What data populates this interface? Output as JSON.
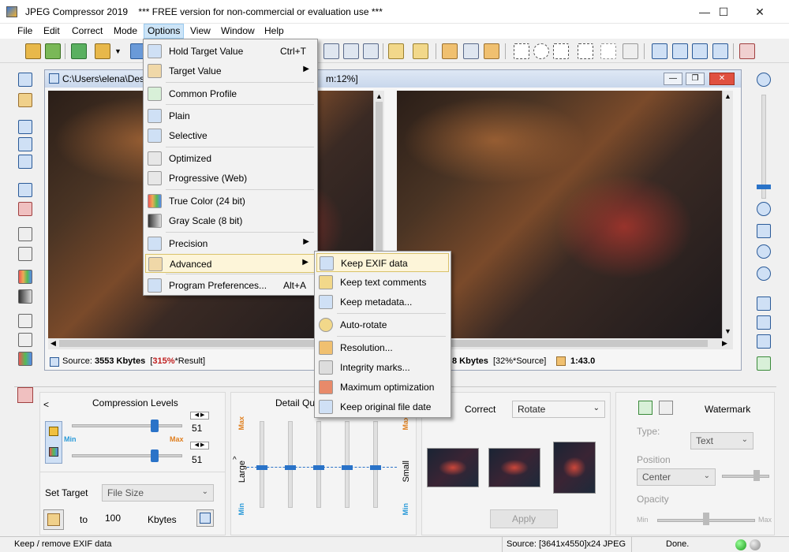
{
  "window": {
    "title": "JPEG Compressor 2019",
    "subtitle": "*** FREE version for non-commercial or evaluation use ***"
  },
  "menubar": [
    "File",
    "Edit",
    "Correct",
    "Mode",
    "Options",
    "View",
    "Window",
    "Help"
  ],
  "document": {
    "path": "C:\\Users\\elena\\Desk",
    "zoom_fragment": "m:12%]",
    "status_left": {
      "source_label": "Source:",
      "source_value": "3553 Kbytes",
      "percent": "315%",
      "percent_label": "*Result]",
      "open_bracket": "["
    },
    "status_right": {
      "kbytes": "8 Kbytes",
      "pct": "[32%*Source]",
      "ratio": "1:43.0"
    }
  },
  "options_menu": {
    "items": [
      {
        "label": "Hold Target Value",
        "shortcut": "Ctrl+T"
      },
      {
        "label": "Target Value",
        "submenu": true
      },
      {
        "label": "Common Profile"
      },
      {
        "label": "Plain"
      },
      {
        "label": "Selective"
      },
      {
        "label": "Optimized"
      },
      {
        "label": "Progressive (Web)"
      },
      {
        "label": "True Color (24 bit)"
      },
      {
        "label": "Gray Scale (8 bit)"
      },
      {
        "label": "Precision",
        "submenu": true
      },
      {
        "label": "Advanced",
        "submenu": true,
        "highlighted": true
      },
      {
        "label": "Program Preferences...",
        "shortcut": "Alt+A"
      }
    ]
  },
  "advanced_submenu": {
    "items": [
      {
        "label": "Keep EXIF data",
        "highlighted": true
      },
      {
        "label": "Keep text comments"
      },
      {
        "label": "Keep metadata..."
      },
      {
        "label": "Auto-rotate"
      },
      {
        "label": "Resolution..."
      },
      {
        "label": "Integrity marks..."
      },
      {
        "label": "Maximum optimization"
      },
      {
        "label": "Keep original file date"
      }
    ]
  },
  "bottom": {
    "compression": {
      "collapse": "<",
      "title": "Compression Levels",
      "min": "Min",
      "max": "Max",
      "value1": "51",
      "value2": "51",
      "progress1": 0.75,
      "progress2": 0.75
    },
    "target": {
      "label": "Set Target",
      "combo": "File Size",
      "to": "to",
      "value": "100",
      "unit": "Kbytes"
    },
    "detail": {
      "title": "Detail Qua",
      "large": "Large",
      "small": "Small",
      "max": "Max",
      "min": "Min",
      "arrow": "^"
    },
    "correct": {
      "title": "Correct",
      "combo": "Rotate",
      "apply": "Apply"
    },
    "watermark": {
      "title": "Watermark",
      "type_label": "Type:",
      "type_value": "Text",
      "position_label": "Position",
      "position_value": "Center",
      "opacity_label": "Opacity",
      "min": "Min",
      "max": "Max"
    }
  },
  "statusbar": {
    "left": "Keep / remove EXIF data",
    "source": "Source: [3641x4550]x24 JPEG",
    "done": "Done."
  },
  "colors": {
    "accent": "#2a73c8",
    "highlight": "#fdf5d9",
    "menu_active": "#cce4f7"
  }
}
